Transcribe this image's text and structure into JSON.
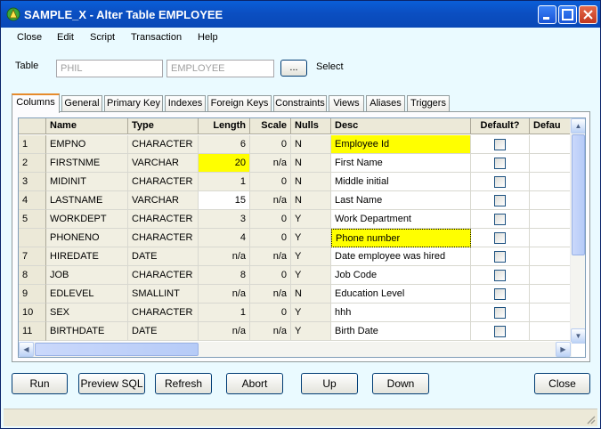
{
  "window": {
    "title": "SAMPLE_X - Alter Table EMPLOYEE"
  },
  "menu": [
    "Close",
    "Edit",
    "Script",
    "Transaction",
    "Help"
  ],
  "table_row": {
    "label": "Table",
    "schema": "PHIL",
    "name": "EMPLOYEE",
    "browse_label": "...",
    "select_label": "Select"
  },
  "tabs": [
    "Columns",
    "General",
    "Primary Key",
    "Indexes",
    "Foreign Keys",
    "Constraints",
    "Views",
    "Aliases",
    "Triggers"
  ],
  "active_tab": "Columns",
  "grid": {
    "headers": [
      "Name",
      "Type",
      "Length",
      "Scale",
      "Nulls",
      "Desc",
      "Default?",
      "Defau"
    ],
    "rows": [
      {
        "rn": "1",
        "name": "EMPNO",
        "type": "CHARACTER",
        "length": "6",
        "scale": "0",
        "nulls": "N",
        "desc": "Employee Id"
      },
      {
        "rn": "2",
        "name": "FIRSTNME",
        "type": "VARCHAR",
        "length": "20",
        "scale": "n/a",
        "nulls": "N",
        "desc": "First Name"
      },
      {
        "rn": "3",
        "name": "MIDINIT",
        "type": "CHARACTER",
        "length": "1",
        "scale": "0",
        "nulls": "N",
        "desc": "Middle initial"
      },
      {
        "rn": "4",
        "name": "LASTNAME",
        "type": "VARCHAR",
        "length": "15",
        "scale": "n/a",
        "nulls": "N",
        "desc": "Last Name"
      },
      {
        "rn": "5",
        "name": "WORKDEPT",
        "type": "CHARACTER",
        "length": "3",
        "scale": "0",
        "nulls": "Y",
        "desc": "Work Department"
      },
      {
        "rn": "",
        "name": "PHONENO",
        "type": "CHARACTER",
        "length": "4",
        "scale": "0",
        "nulls": "Y",
        "desc": "Phone number"
      },
      {
        "rn": "7",
        "name": "HIREDATE",
        "type": "DATE",
        "length": "n/a",
        "scale": "n/a",
        "nulls": "Y",
        "desc": "Date employee was hired"
      },
      {
        "rn": "8",
        "name": "JOB",
        "type": "CHARACTER",
        "length": "8",
        "scale": "0",
        "nulls": "Y",
        "desc": "Job Code"
      },
      {
        "rn": "9",
        "name": "EDLEVEL",
        "type": "SMALLINT",
        "length": "n/a",
        "scale": "n/a",
        "nulls": "N",
        "desc": "Education Level"
      },
      {
        "rn": "10",
        "name": "SEX",
        "type": "CHARACTER",
        "length": "1",
        "scale": "0",
        "nulls": "Y",
        "desc": "hhh"
      },
      {
        "rn": "11",
        "name": "BIRTHDATE",
        "type": "DATE",
        "length": "n/a",
        "scale": "n/a",
        "nulls": "Y",
        "desc": "Birth Date"
      }
    ]
  },
  "buttons": [
    "Run",
    "Preview SQL",
    "Refresh",
    "Abort",
    "Up",
    "Down",
    "Close"
  ],
  "colors": {
    "highlight": "#ffff00",
    "title_bar": "#0b4fc2",
    "window_bg": "#eafaff"
  }
}
